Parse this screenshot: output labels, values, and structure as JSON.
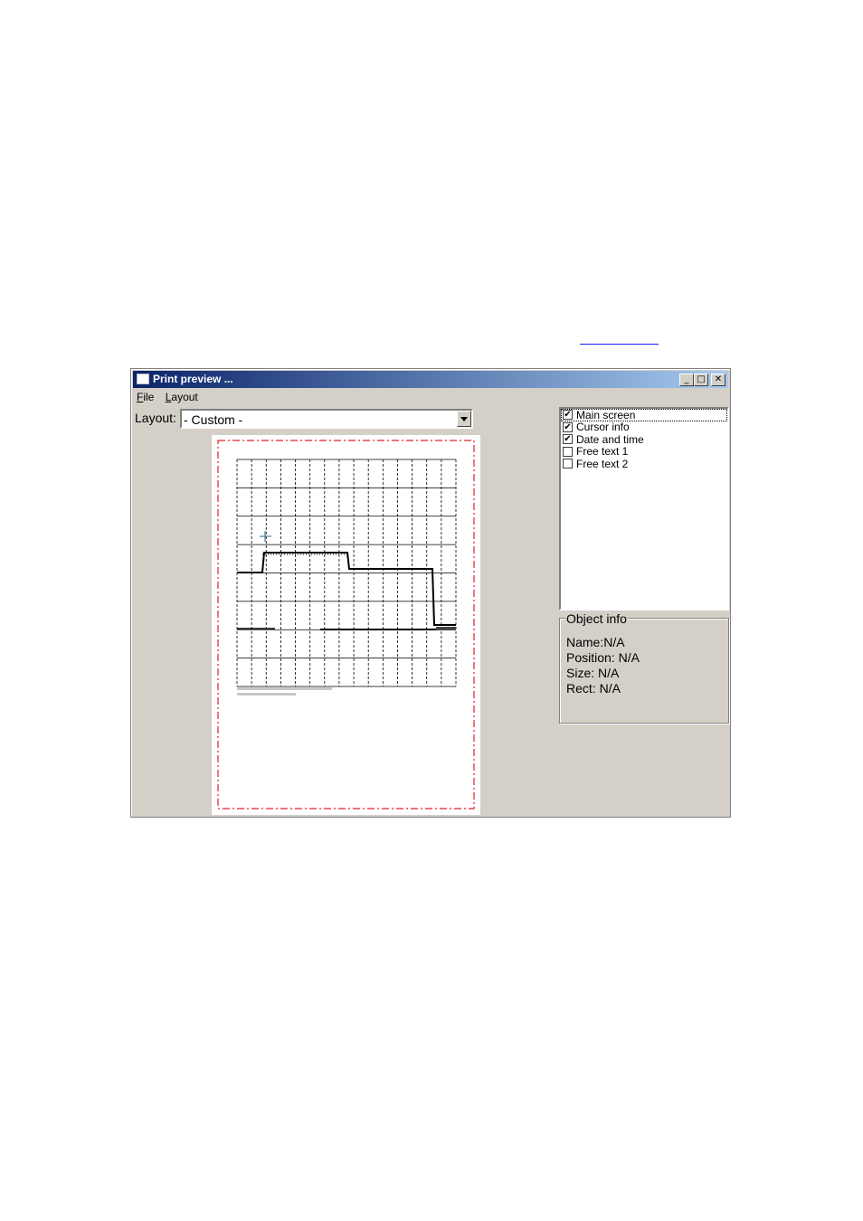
{
  "window": {
    "title": "Print preview ..."
  },
  "title_buttons": {
    "minimize": "_",
    "maximize": "□",
    "close": "✕"
  },
  "menu": [
    {
      "label": "File",
      "accel": "F",
      "rest": "ile"
    },
    {
      "label": "Layout",
      "accel": "L",
      "rest": "ayout"
    }
  ],
  "layout_label": "Layout:",
  "layout_select": {
    "value": "- Custom -"
  },
  "components": [
    {
      "label": "Main screen",
      "checked": true
    },
    {
      "label": "Cursor info",
      "checked": true
    },
    {
      "label": "Date and time",
      "checked": true
    },
    {
      "label": "Free text 1",
      "checked": false
    },
    {
      "label": "Free text 2",
      "checked": false
    }
  ],
  "object_info": {
    "title": "Object info",
    "name": "Name:N/A",
    "position": "Position:  N/A",
    "size": "Size:   N/A",
    "rect": "Rect:  N/A"
  },
  "colors": {
    "title_start": "#0a246a",
    "title_end": "#a6caf0",
    "margin_border": "#e0202a",
    "window_bg": "#d4d0c8"
  }
}
